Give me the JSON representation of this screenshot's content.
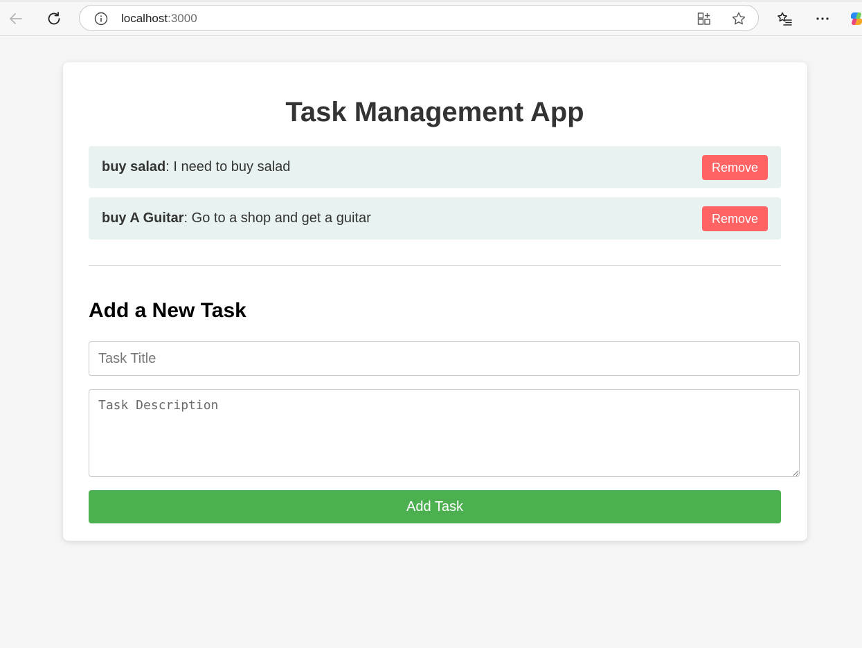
{
  "browser": {
    "url_host": "localhost",
    "url_port": ":3000"
  },
  "app": {
    "title": "Task Management App"
  },
  "tasks": [
    {
      "title": "buy salad",
      "separator": ": ",
      "description": "I need to buy salad",
      "remove_label": "Remove"
    },
    {
      "title": "buy A Guitar",
      "separator": ": ",
      "description": "Go to a shop and get a guitar",
      "remove_label": "Remove"
    }
  ],
  "form": {
    "heading": "Add a New Task",
    "title_placeholder": "Task Title",
    "title_value": "",
    "description_placeholder": "Task Description",
    "description_value": "",
    "submit_label": "Add Task"
  },
  "colors": {
    "remove": "#ff6363",
    "add": "#4caf50",
    "task_bg": "#e8f3f1",
    "page_bg": "#f4f5f4"
  }
}
